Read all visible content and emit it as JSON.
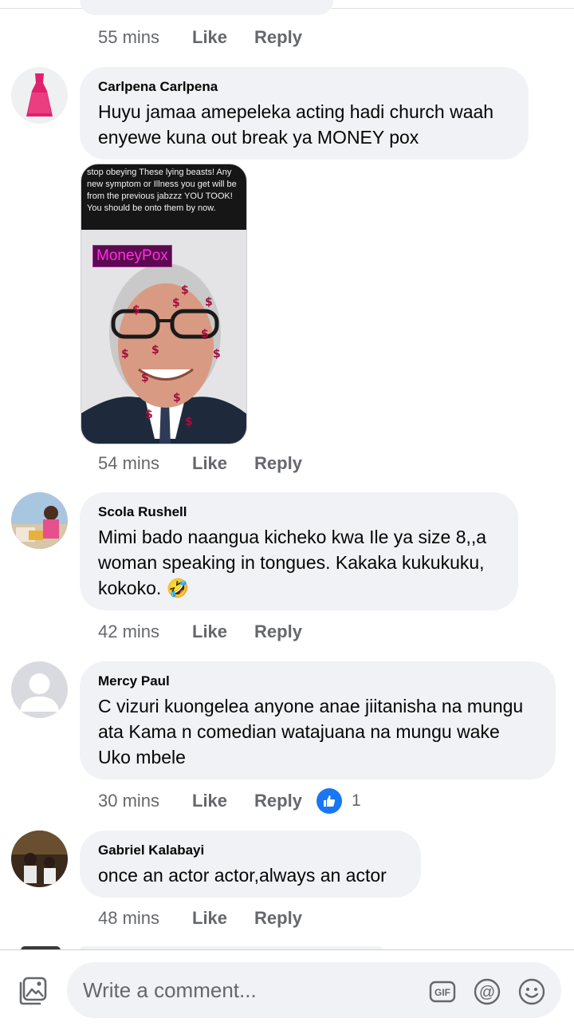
{
  "comments": [
    {
      "time": "55 mins",
      "like": "Like",
      "reply": "Reply"
    },
    {
      "author": "Carlpena Carlpena",
      "lines": [
        "Huyu jamaa amepeleka acting hadi church waah",
        "enyewe kuna out break ya MONEY pox"
      ],
      "time": "54 mins",
      "like": "Like",
      "reply": "Reply",
      "attachment": {
        "caption": "stop obeying These lying beasts! Any new symptom or Illness you get will be from the previous jabzzz YOU TOOK!  You should be onto them by now.",
        "badge": "MoneyPox"
      }
    },
    {
      "author": "Scola Rushell",
      "lines": [
        "Mimi bado naangua kicheko kwa Ile ya size 8,,a",
        "woman speaking in tongues. Kakaka kukukuku,",
        "kokoko. 🤣"
      ],
      "time": "42 mins",
      "like": "Like",
      "reply": "Reply"
    },
    {
      "author": "Mercy Paul",
      "lines": [
        "C vizuri kuongelea anyone anae jiitanisha na mungu",
        "ata Kama n comedian watajuana na mungu wake",
        "Uko mbele"
      ],
      "time": "30 mins",
      "like": "Like",
      "reply": "Reply",
      "reaction_count": "1",
      "reaction_icon": "like-icon"
    },
    {
      "author": "Gabriel Kalabayi",
      "lines": [
        "once an actor actor,always an actor"
      ],
      "time": "48 mins",
      "like": "Like",
      "reply": "Reply"
    }
  ],
  "composer": {
    "placeholder": "Write a comment...",
    "icons": [
      "photo-icon",
      "gif-icon",
      "mention-icon",
      "emoji-icon"
    ],
    "gif_label": "GIF",
    "mention_label": "@"
  },
  "colors": {
    "bubble": "#f0f2f5",
    "meta_text": "#65676b",
    "like_blue": "#1877f2"
  }
}
